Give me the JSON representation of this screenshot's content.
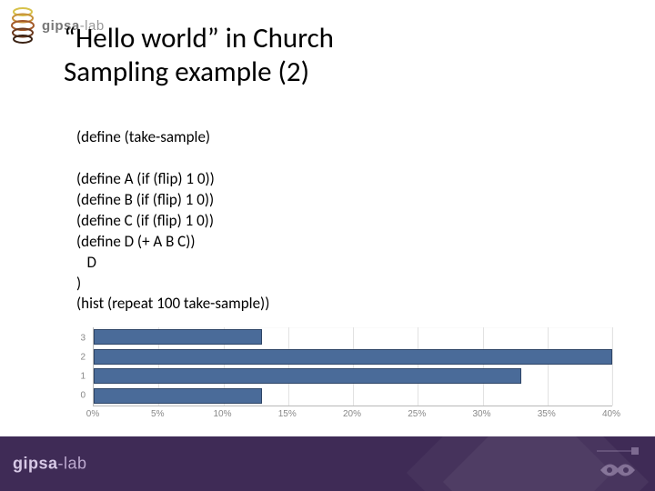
{
  "brand": {
    "bold": "gipsa",
    "light": "-lab"
  },
  "title": {
    "line1": "“Hello world” in Church",
    "line2": "Sampling example (2)"
  },
  "code": {
    "l1": "(define (take-sample)",
    "blank": "",
    "l2": "(define A (if (flip) 1 0))",
    "l3": "(define B (if (flip) 1 0))",
    "l4": "(define C (if (flip) 1 0))",
    "l5": "(define D (+ A B C))",
    "l6": "   D",
    "l7": ")",
    "l8": "(hist (repeat 100 take-sample))"
  },
  "chart_data": {
    "type": "bar",
    "orientation": "horizontal",
    "categories": [
      "3",
      "2",
      "1",
      "0"
    ],
    "values": [
      13,
      41,
      33,
      13
    ],
    "xlabel": "",
    "ylabel": "",
    "title": "",
    "xlim": [
      0,
      40
    ],
    "xticks": [
      0,
      5,
      10,
      15,
      20,
      25,
      30,
      35,
      40
    ],
    "xtick_labels": [
      "0%",
      "5%",
      "10%",
      "15%",
      "20%",
      "25%",
      "30%",
      "35%",
      "40%"
    ],
    "bar_color": "#4a6b99"
  }
}
